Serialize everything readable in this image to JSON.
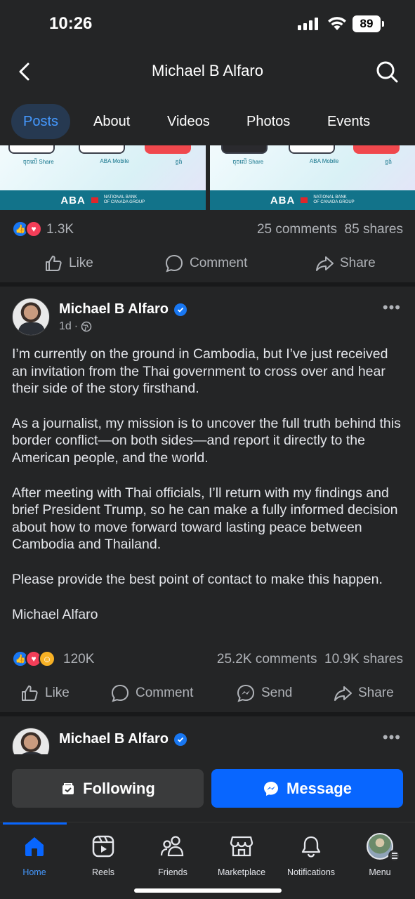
{
  "status_bar": {
    "time": "10:26",
    "battery": "89"
  },
  "header": {
    "title": "Michael B Alfaro"
  },
  "tabs": [
    {
      "label": "Posts",
      "active": true
    },
    {
      "label": "About"
    },
    {
      "label": "Videos"
    },
    {
      "label": "Photos"
    },
    {
      "label": "Events"
    }
  ],
  "banner": {
    "brand": "ABA",
    "partner_line1": "NATIONAL BANK",
    "partner_line2": "OF CANADA GROUP",
    "left_cols": [
      "ចុចលើ Share",
      "ABA Mobile",
      "ខ្ទង់"
    ],
    "right_cols": [
      "ចុចលើ Share",
      "ABA Mobile",
      "ខ្ទង់"
    ]
  },
  "post1": {
    "reaction_count": "1.3K",
    "comments": "25 comments",
    "shares": "85 shares",
    "actions": {
      "like": "Like",
      "comment": "Comment",
      "share": "Share"
    }
  },
  "post2": {
    "author": "Michael B Alfaro",
    "time": "1d",
    "paragraphs": [
      "I’m currently on the ground in Cambodia, but I’ve just received an invitation from the Thai government to cross over and hear their side of the story firsthand.",
      "As a journalist, my mission is to uncover the full truth behind this border conflict—on both sides—and report it directly to the American people, and the world.",
      "After meeting with Thai officials, I’ll return with my findings and brief President Trump, so he can make a fully informed decision about how to move forward toward lasting peace between Cambodia and Thailand.",
      "Please provide the best point of contact to make this happen."
    ],
    "signature": "Michael Alfaro",
    "reaction_count": "120K",
    "comments": "25.2K comments",
    "shares": "10.9K shares",
    "actions": {
      "like": "Like",
      "comment": "Comment",
      "send": "Send",
      "share": "Share"
    }
  },
  "post3": {
    "author": "Michael B Alfaro"
  },
  "cta": {
    "following": "Following",
    "message": "Message"
  },
  "bottom_tabs": [
    {
      "label": "Home",
      "icon": "home-icon",
      "active": true
    },
    {
      "label": "Reels",
      "icon": "reels-icon"
    },
    {
      "label": "Friends",
      "icon": "friends-icon"
    },
    {
      "label": "Marketplace",
      "icon": "marketplace-icon"
    },
    {
      "label": "Notifications",
      "icon": "bell-icon"
    },
    {
      "label": "Menu",
      "icon": "menu-avatar-icon"
    }
  ],
  "colors": {
    "accent": "#0866ff",
    "active_tab": "#4599ff",
    "background": "#242526"
  }
}
